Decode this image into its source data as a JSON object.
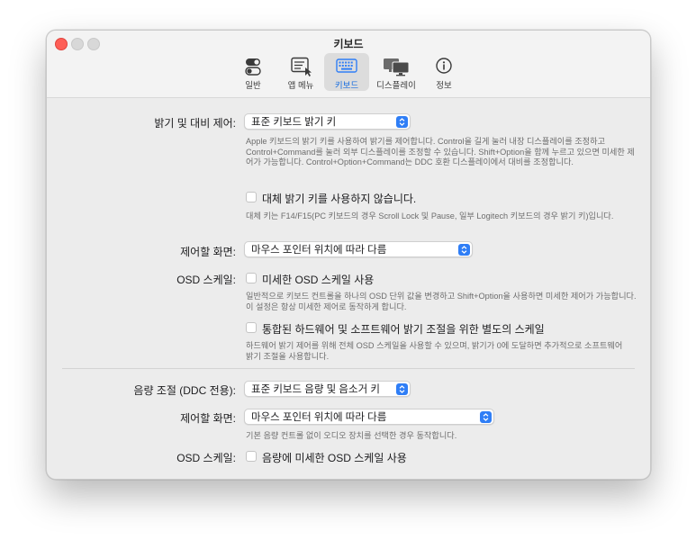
{
  "window": {
    "title": "키보드"
  },
  "toolbar": {
    "items": [
      {
        "label": "일반",
        "icon": "toggle-switches-icon",
        "active": false
      },
      {
        "label": "앱 메뉴",
        "icon": "app-menu-icon",
        "active": false
      },
      {
        "label": "키보드",
        "icon": "keyboard-icon",
        "active": true
      },
      {
        "label": "디스플레이",
        "icon": "displays-icon",
        "active": false
      },
      {
        "label": "정보",
        "icon": "info-icon",
        "active": false
      }
    ]
  },
  "brightness": {
    "label": "밝기 및 대비 제어:",
    "select_value": "표준 키보드 밝기 키",
    "description": "Apple 키보드의 밝기 키를 사용하여 밝기를 제어합니다. Control을 길게 눌러 내장 디스플레이를 조정하고 Control+Command를 눌러 외부 디스플레이를 조정할 수 있습니다. Shift+Option을 함께 누르고 있으면 미세한 제어가 가능합니다. Control+Option+Command는 DDC 호환 디스플레이에서 대비를 조정합니다.",
    "alt_keys_label": "대체 밝기 키를 사용하지 않습니다.",
    "alt_keys_checked": false,
    "alt_keys_description": "대체 키는 F14/F15(PC 키보드의 경우 Scroll Lock 및 Pause, 일부 Logitech 키보드의 경우 밝기 키)입니다.",
    "screen_label": "제어할 화면:",
    "screen_value": "마우스 포인터 위치에 따라 다름",
    "osd_label": "OSD 스케일:",
    "osd_fine_label": "미세한 OSD 스케일 사용",
    "osd_fine_checked": false,
    "osd_fine_description": "일반적으로 키보드 컨트롤을 하나의 OSD 단위 값을 변경하고 Shift+Option을 사용하면 미세한 제어가 가능합니다. 이 설정은 항상 미세한 제어로 동작하게 합니다.",
    "combined_label": "통합된 하드웨어 및 소프트웨어 밝기 조절을 위한 별도의 스케일",
    "combined_checked": false,
    "combined_description": "하드웨어 밝기 제어를 위해 전체 OSD 스케일을 사용할 수 있으며, 밝기가 0에 도달하면 추가적으로 소프트웨어 밝기 조절을 사용합니다."
  },
  "volume": {
    "label": "음량 조절 (DDC 전용):",
    "select_value": "표준 키보드 음량 및 음소거 키",
    "screen_label": "제어할 화면:",
    "screen_value": "마우스 포인터 위치에 따라 다름",
    "screen_description": "기본 음량 컨트롤 없이 오디오 장치를 선택한 경우 동작합니다.",
    "osd_label": "OSD 스케일:",
    "osd_fine_label": "음량에 미세한 OSD 스케일 사용",
    "osd_fine_checked": false
  },
  "colors": {
    "accent": "#2f7ef6",
    "close": "#fe5f57",
    "active_tab_text": "#1a6fe0"
  }
}
